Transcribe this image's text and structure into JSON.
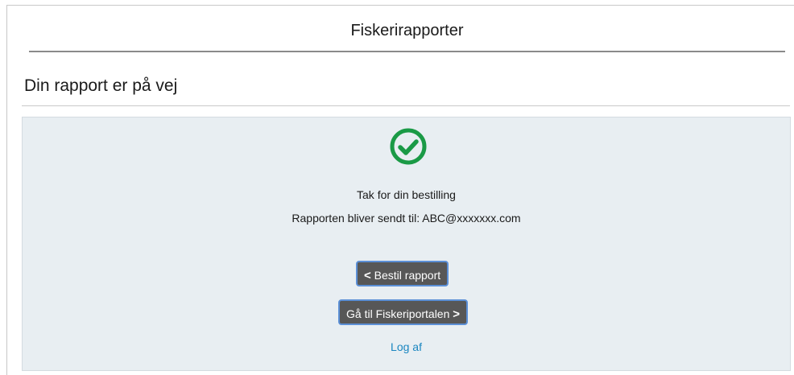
{
  "app": {
    "title": "Fiskerirapporter"
  },
  "page": {
    "title": "Din rapport er på vej"
  },
  "confirmation": {
    "icon": "check-circle-icon",
    "thanks": "Tak for din bestilling",
    "sent_to_label": "Rapporten bliver sendt til: ABC@xxxxxxx.com"
  },
  "actions": {
    "back": {
      "arrow": "<",
      "label": "Bestil rapport"
    },
    "portal": {
      "label": "Gå til Fiskeriportalen",
      "arrow": ">"
    },
    "logout": "Log af"
  },
  "colors": {
    "success": "#1a9a46",
    "button_bg": "#575757",
    "button_border": "#5b8fd6",
    "link": "#1a86c0",
    "panel_bg": "#e8eef2"
  }
}
